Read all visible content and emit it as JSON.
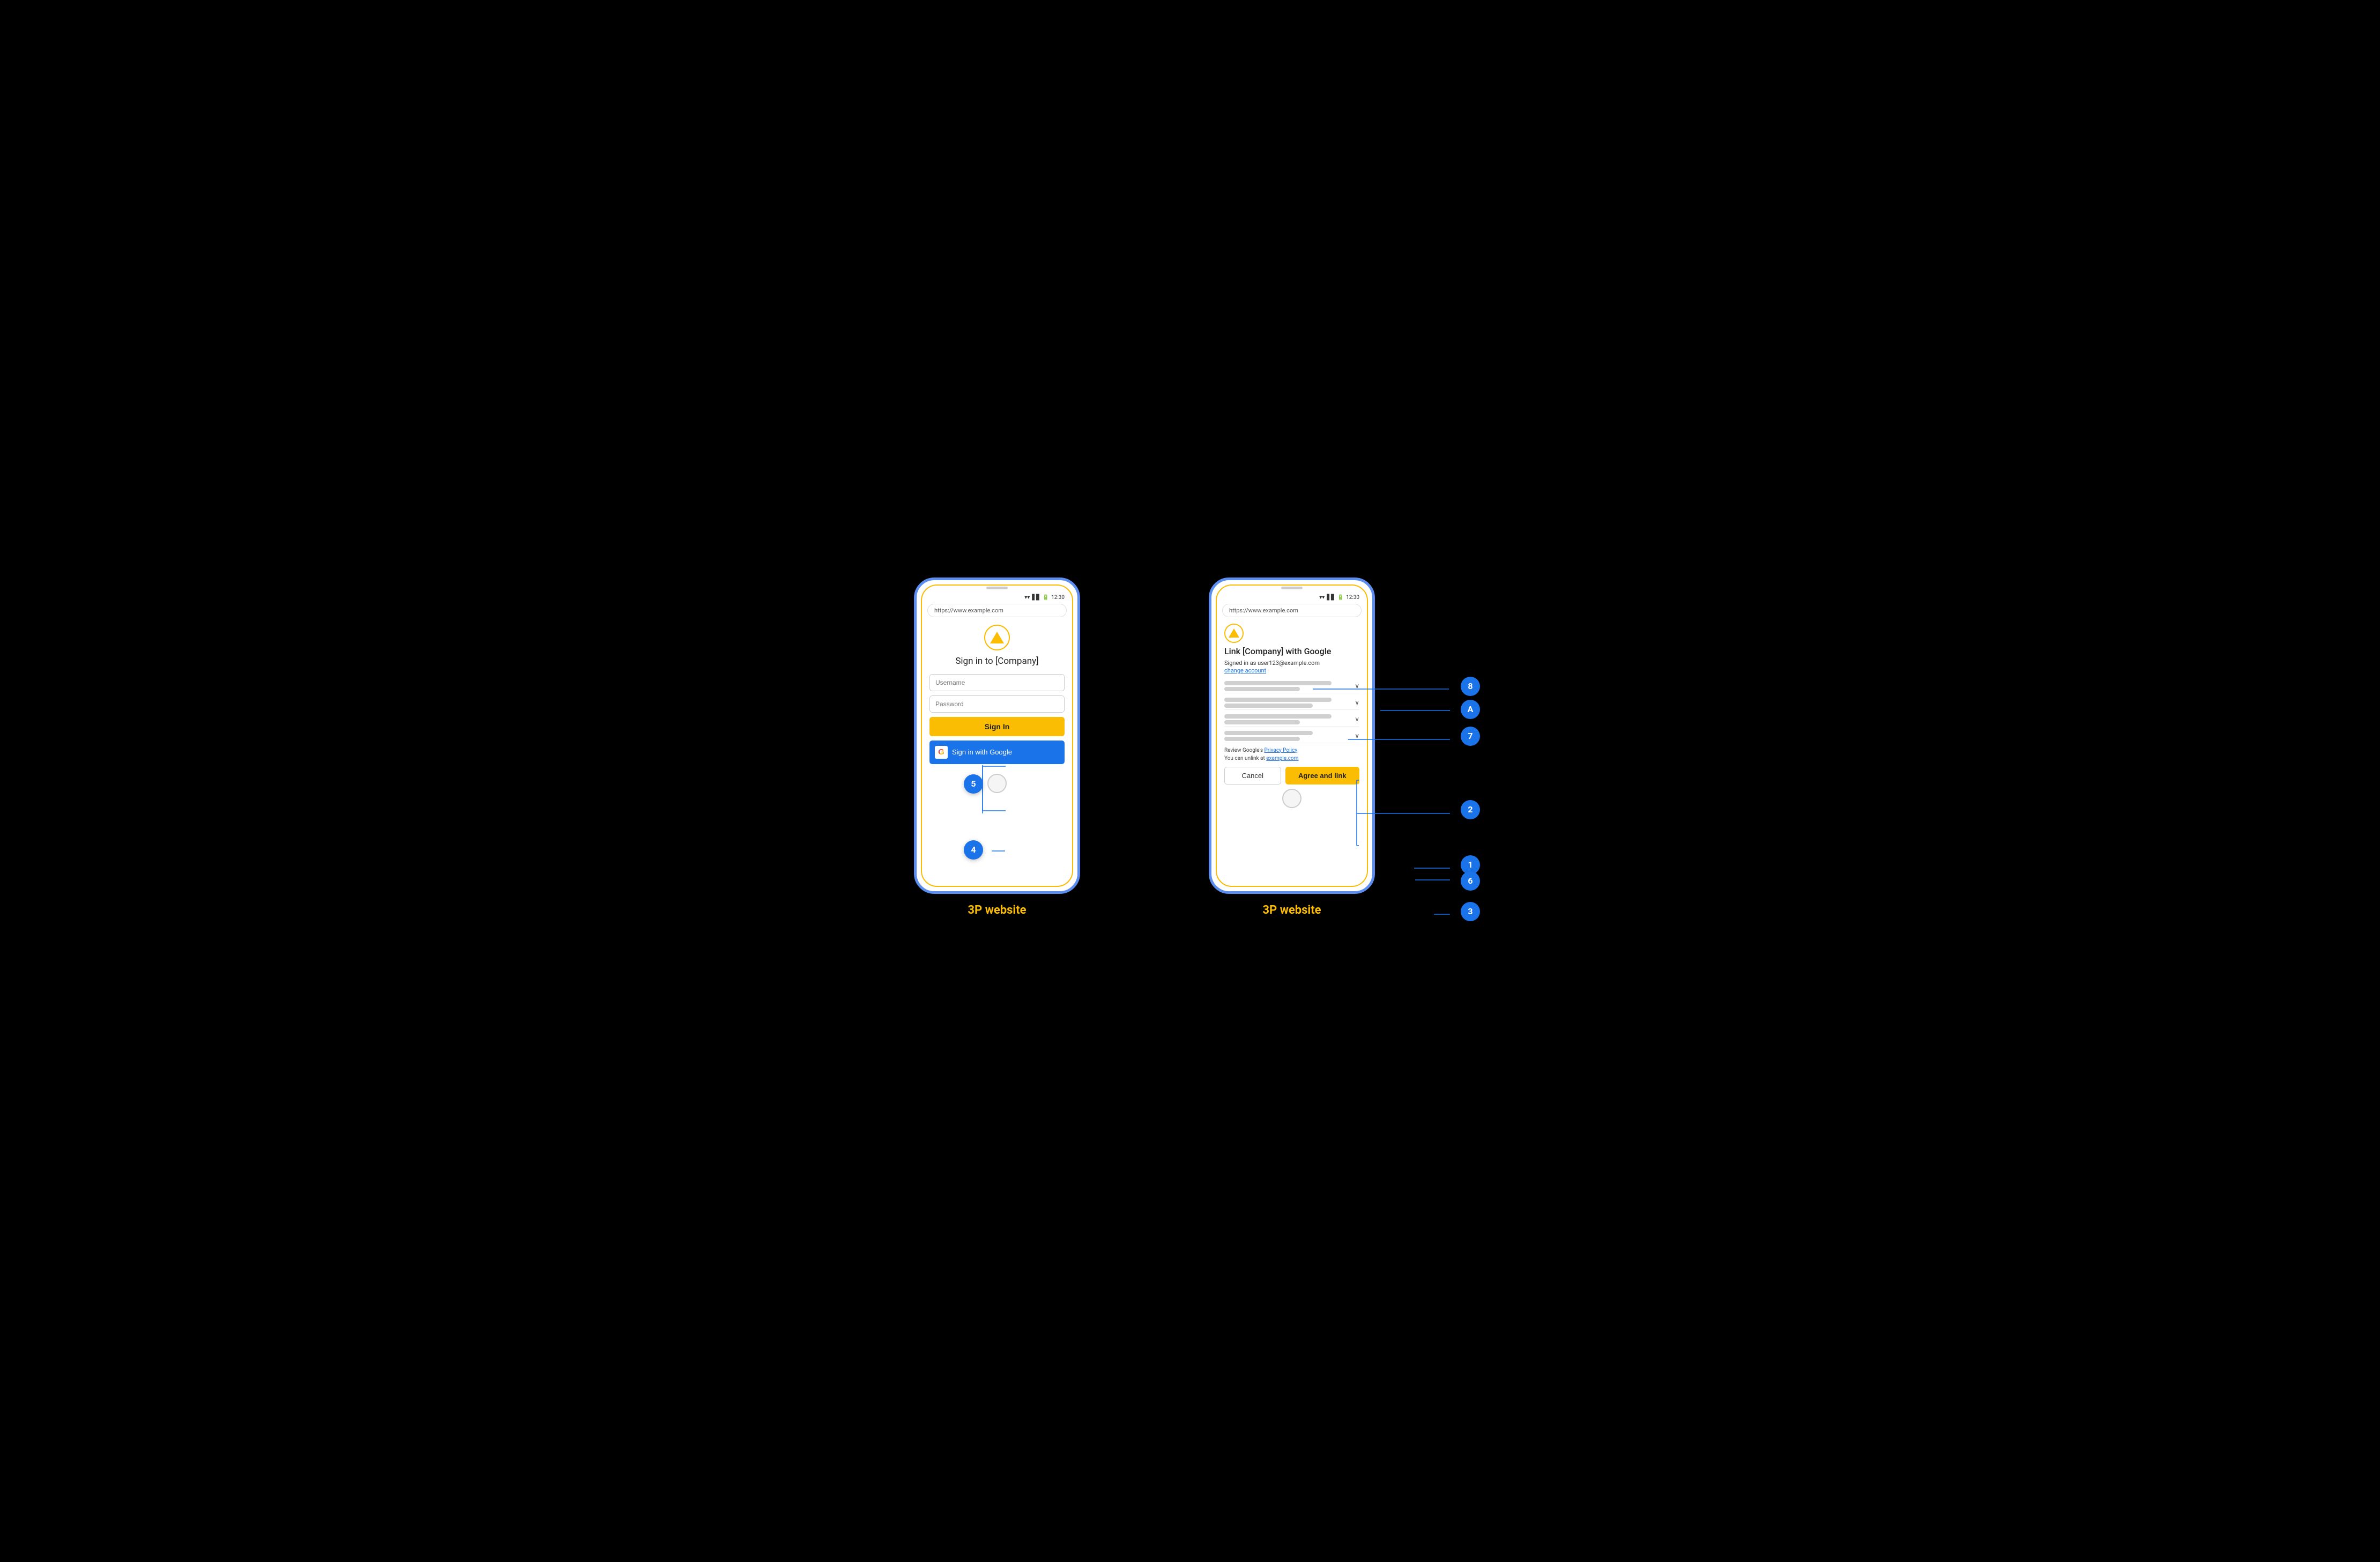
{
  "diagram": {
    "background": "#000000",
    "labels": {
      "phone1_label": "3P website",
      "phone2_label": "3P website"
    },
    "badges": [
      {
        "id": "badge-5",
        "label": "5"
      },
      {
        "id": "badge-4",
        "label": "4"
      },
      {
        "id": "badge-8",
        "label": "8"
      },
      {
        "id": "badge-A",
        "label": "A"
      },
      {
        "id": "badge-7",
        "label": "7"
      },
      {
        "id": "badge-2",
        "label": "2"
      },
      {
        "id": "badge-1",
        "label": "1"
      },
      {
        "id": "badge-6",
        "label": "6"
      },
      {
        "id": "badge-3",
        "label": "3"
      }
    ]
  },
  "phone1": {
    "status_bar": {
      "time": "12:30",
      "signal_icon": "wifi-signal",
      "battery_icon": "battery"
    },
    "address_bar": "https://www.example.com",
    "logo_alt": "Company logo triangle",
    "page_title": "Sign in to [Company]",
    "username_placeholder": "Username",
    "password_placeholder": "Password",
    "signin_button": "Sign In",
    "google_button": "Sign in with Google",
    "home_button": ""
  },
  "phone2": {
    "status_bar": {
      "time": "12:30",
      "signal_icon": "wifi-signal",
      "battery_icon": "battery"
    },
    "address_bar": "https://www.example.com",
    "logo_alt": "Company logo triangle",
    "link_title": "Link [Company] with Google",
    "signed_in_text": "Signed in as user123@example.com",
    "change_account": "change account",
    "permissions": [
      {
        "lines": [
          "long",
          "short"
        ],
        "has_chevron": true
      },
      {
        "lines": [
          "long",
          "med"
        ],
        "has_chevron": true
      },
      {
        "lines": [
          "long",
          "short"
        ],
        "has_chevron": true
      },
      {
        "lines": [
          "med",
          "short"
        ],
        "has_chevron": true
      }
    ],
    "privacy_policy_text": "Review Google's ",
    "privacy_policy_link": "Privacy Policy",
    "unlink_text": "You can unlink at ",
    "unlink_link": "example.com",
    "cancel_button": "Cancel",
    "agree_button": "Agree and link"
  }
}
